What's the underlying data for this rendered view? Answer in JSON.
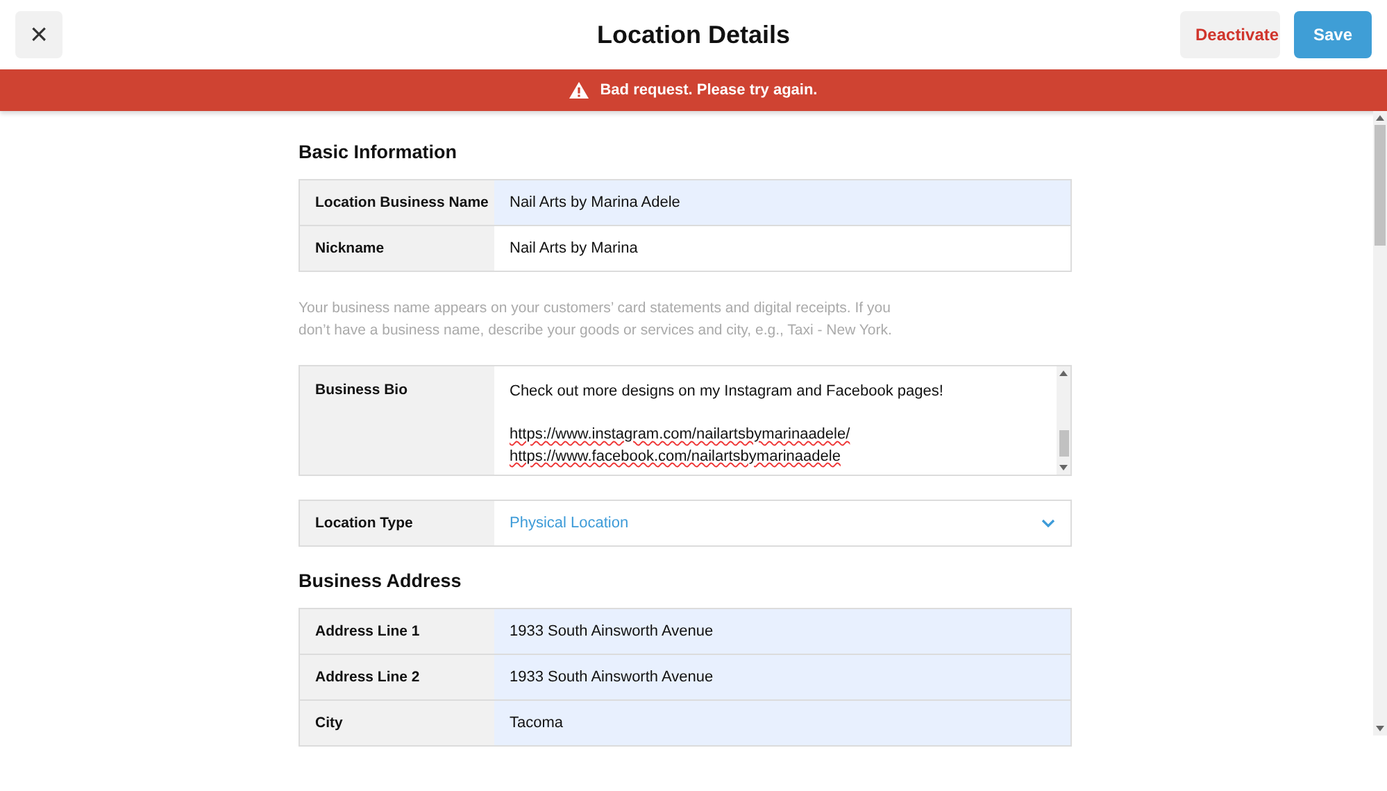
{
  "header": {
    "close_icon": "×",
    "title": "Location Details",
    "buttons": [
      {
        "label": "Deactivate",
        "kind": "secondary"
      },
      {
        "label": "Save",
        "kind": "primary"
      }
    ]
  },
  "alert": {
    "message": "Bad request. Please try again."
  },
  "sections": [
    {
      "title": "Basic Information",
      "groups": [
        {
          "fields": [
            {
              "kind": "text",
              "label": "Location Business Name",
              "value": "Nail Arts by Marina Adele",
              "autofilled": true
            },
            {
              "kind": "text",
              "label": "Nickname",
              "value": "Nail Arts by Marina",
              "autofilled": false
            }
          ],
          "help": "Your business name appears on your customers’ card statements and digital receipts. If you don’t have a business name, describe your goods or services and city, e.g., Taxi - New York."
        },
        {
          "fields": [
            {
              "kind": "textarea",
              "label": "Business Bio",
              "lines": [
                "Check out more designs on my Instagram and Facebook pages!",
                "https://www.instagram.com/nailartsbymarinaadele/",
                "https://www.facebook.com/nailartsbymarinaadele"
              ]
            }
          ]
        },
        {
          "fields": [
            {
              "kind": "select",
              "label": "Location Type",
              "value": "Physical Location"
            }
          ]
        }
      ]
    },
    {
      "title": "Business Address",
      "groups": [
        {
          "fields": [
            {
              "kind": "text",
              "label": "Address Line 1",
              "value": "1933 South Ainsworth Avenue",
              "autofilled": true
            },
            {
              "kind": "text",
              "label": "Address Line 2",
              "value": "1933 South Ainsworth Avenue",
              "autofilled": true
            },
            {
              "kind": "text",
              "label": "City",
              "value": "Tacoma",
              "autofilled": true
            }
          ]
        }
      ]
    }
  ]
}
